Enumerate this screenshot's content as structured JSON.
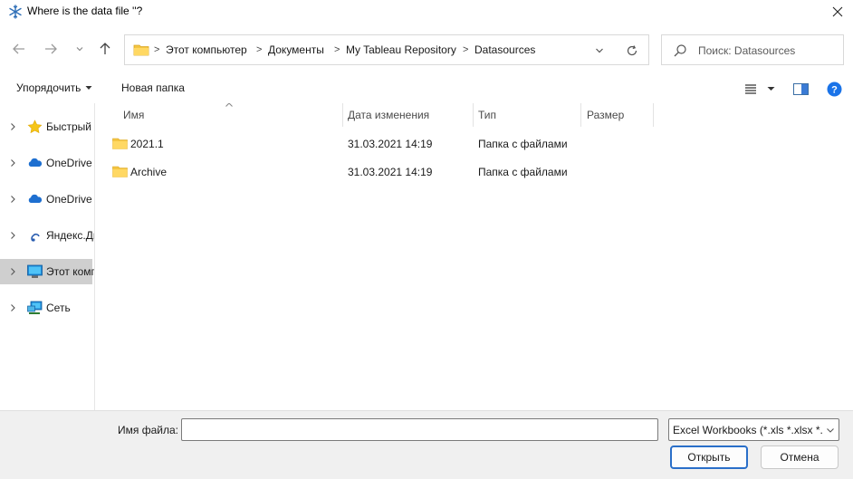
{
  "window": {
    "title": "Where is the data file ''?",
    "icon": "snowflake-icon",
    "close_icon": "close-icon"
  },
  "nav": {
    "back_icon": "arrow-left-icon",
    "forward_icon": "arrow-right-icon",
    "recent_icon": "chevron-down-icon",
    "up_icon": "arrow-up-icon"
  },
  "address": {
    "folder_icon": "folder-icon",
    "crumbs": [
      "Этот компьютер",
      "Документы",
      "My Tableau Repository",
      "Datasources"
    ],
    "separator": ">"
  },
  "search": {
    "placeholder": "Поиск: Datasources"
  },
  "toolbar": {
    "organize_label": "Упорядочить",
    "new_folder_label": "Новая папка"
  },
  "sidebar": {
    "items": [
      {
        "label": "Быстрый доступ",
        "icon": "star-icon",
        "selected": false
      },
      {
        "label": "OneDrive",
        "icon": "cloud-icon",
        "selected": false
      },
      {
        "label": "OneDrive",
        "icon": "cloud-icon",
        "selected": false
      },
      {
        "label": "Яндекс.Диск",
        "icon": "yandex-disk-icon",
        "selected": false
      },
      {
        "label": "Этот компьютер",
        "icon": "computer-icon",
        "selected": true
      },
      {
        "label": "Сеть",
        "icon": "network-icon",
        "selected": false
      }
    ]
  },
  "columns": {
    "name": "Имя",
    "date": "Дата изменения",
    "type": "Тип",
    "size": "Размер"
  },
  "files": [
    {
      "name": "2021.1",
      "date": "31.03.2021 14:19",
      "type": "Папка с файлами",
      "size": ""
    },
    {
      "name": "Archive",
      "date": "31.03.2021 14:19",
      "type": "Папка с файлами",
      "size": ""
    }
  ],
  "footer": {
    "filename_label": "Имя файла:",
    "filename_value": "",
    "filetype_selected": "Excel Workbooks (*.xls *.xlsx *.xlsm)",
    "open_label": "Открыть",
    "cancel_label": "Отмена"
  },
  "colors": {
    "accent": "#2a6fc9",
    "folder": "#f4c542",
    "selected_bg": "#cfcfcf",
    "help": "#1a73e8"
  }
}
